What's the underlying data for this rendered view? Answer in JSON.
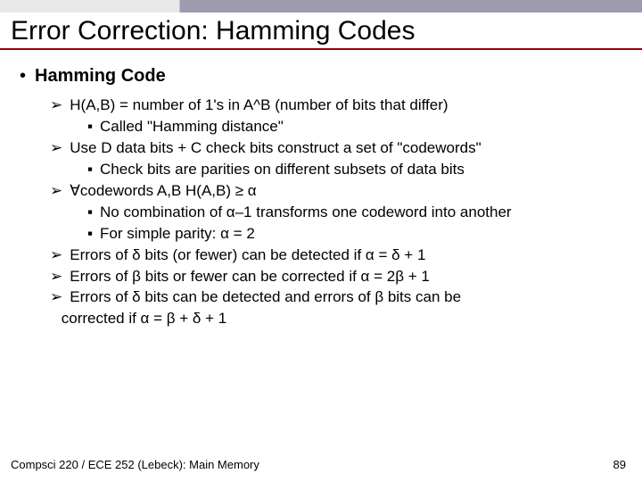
{
  "title": "Error Correction: Hamming Codes",
  "heading": "Hamming Code",
  "items": {
    "i0": {
      "text": "H(A,B) = number of 1's in A^B (number of bits that differ)"
    },
    "i0s0": {
      "text": "Called \"Hamming distance\""
    },
    "i1": {
      "text": "Use D data bits + C check bits construct a set of \"codewords\""
    },
    "i1s0": {
      "text": "Check bits are parities on different subsets of data bits"
    },
    "i2": {
      "text": "∀codewords A,B H(A,B) ≥ α"
    },
    "i2s0": {
      "text": "No combination of α–1 transforms one codeword into another"
    },
    "i2s1": {
      "text": "For simple parity: α = 2"
    },
    "i3": {
      "text": "Errors of δ bits (or fewer) can be detected if α = δ + 1"
    },
    "i4": {
      "text": "Errors of β bits or fewer can be corrected if α = 2β + 1"
    },
    "i5": {
      "text": "Errors of δ bits can be detected and errors of β bits can be"
    },
    "i5cont": {
      "text": "corrected if α = β + δ + 1"
    }
  },
  "footer": {
    "left": "Compsci 220 / ECE 252 (Lebeck): Main Memory",
    "right": "89"
  }
}
